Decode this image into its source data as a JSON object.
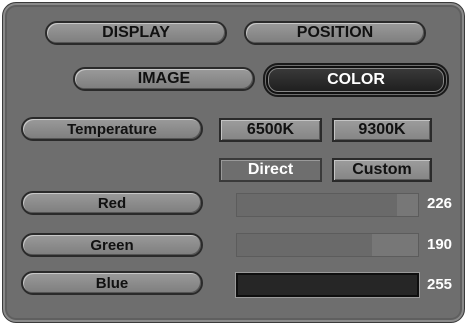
{
  "tabs": {
    "display": "DISPLAY",
    "position": "POSITION",
    "image": "IMAGE",
    "color": "COLOR"
  },
  "temperature": {
    "label": "Temperature",
    "presets": [
      "6500K",
      "9300K"
    ],
    "modes": [
      "Direct",
      "Custom"
    ],
    "selected_mode": "Direct"
  },
  "channels": [
    {
      "label": "Red",
      "value": "226",
      "level": 226
    },
    {
      "label": "Green",
      "value": "190",
      "level": 190
    },
    {
      "label": "Blue",
      "value": "255",
      "level": 255
    }
  ],
  "max_level": 255
}
